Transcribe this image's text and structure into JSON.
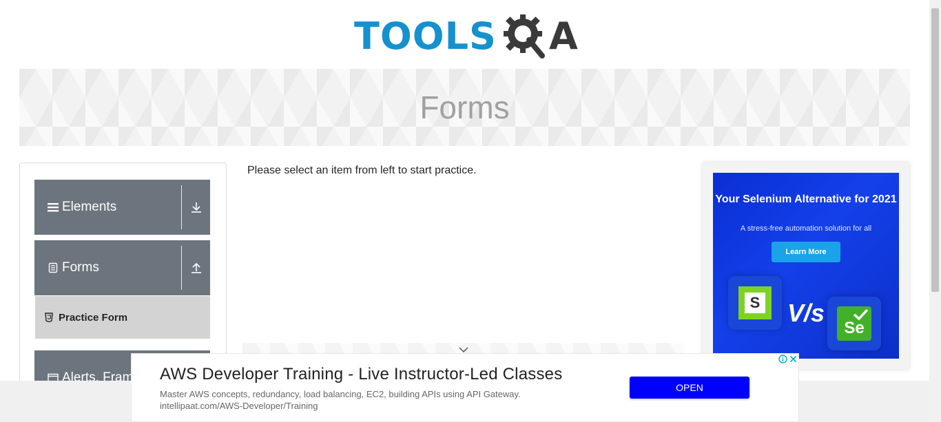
{
  "header": {
    "logo_text_tools": "TOOLS",
    "logo_text_a": "A"
  },
  "banner": {
    "title": "Forms"
  },
  "sidebar": {
    "groups": [
      {
        "label": "Elements",
        "icon": "hamburger-icon",
        "toggle_icon": "download-arrow-icon"
      },
      {
        "label": "Forms",
        "icon": "document-icon",
        "toggle_icon": "upload-arrow-icon",
        "items": [
          {
            "label": "Practice Form",
            "icon": "html5-shield-icon"
          }
        ]
      },
      {
        "label": "Alerts, Frame & Windows",
        "icon": "window-icon"
      }
    ]
  },
  "main": {
    "message": "Please select an item from left to start practice."
  },
  "side_ad": {
    "title": "Your Selenium Alternative for 2021",
    "subtitle": "A stress-free automation solution for all",
    "button_label": "Learn More",
    "s_letter": "S",
    "vs_text": "V/s",
    "se_letter": "Se"
  },
  "bottom_ad": {
    "title": "AWS Developer Training - Live Instructor-Led Classes",
    "description": "Master AWS concepts, redundancy, load balancing, EC2, building APIs using API Gateway.",
    "url": "intellipaat.com/AWS-Developer/Training",
    "button_label": "OPEN"
  },
  "colors": {
    "brand_blue": "#1591cf",
    "sidebar_group": "#6c757d",
    "active_item": "#d3d3d3",
    "ad_button": "#0000ff"
  }
}
